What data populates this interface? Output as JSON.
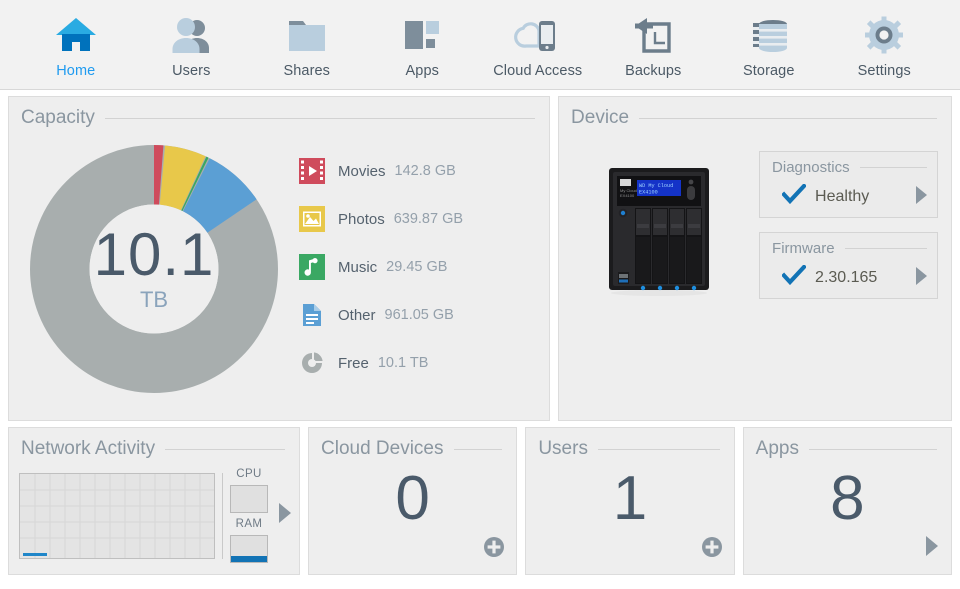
{
  "nav": {
    "items": [
      {
        "label": "Home",
        "icon": "home-icon",
        "active": true
      },
      {
        "label": "Users",
        "icon": "users-icon",
        "active": false
      },
      {
        "label": "Shares",
        "icon": "folder-icon",
        "active": false
      },
      {
        "label": "Apps",
        "icon": "apps-grid-icon",
        "active": false
      },
      {
        "label": "Cloud Access",
        "icon": "cloud-phone-icon",
        "active": false
      },
      {
        "label": "Backups",
        "icon": "backup-arrow-icon",
        "active": false
      },
      {
        "label": "Storage",
        "icon": "storage-disks-icon",
        "active": false
      },
      {
        "label": "Settings",
        "icon": "gear-icon",
        "active": false
      }
    ],
    "active_color": "#1f9bf0",
    "label_color": "#4c5a66"
  },
  "capacity": {
    "title": "Capacity",
    "center_value": "10.1",
    "center_unit": "TB",
    "legend": [
      {
        "name": "Movies",
        "value": "142.8 GB",
        "icon": "film-icon",
        "color": "#cf4b5c"
      },
      {
        "name": "Photos",
        "value": "639.87 GB",
        "icon": "picture-icon",
        "color": "#e8c84a"
      },
      {
        "name": "Music",
        "value": "29.45 GB",
        "icon": "music-icon",
        "color": "#3aa863"
      },
      {
        "name": "Other",
        "value": "961.05 GB",
        "icon": "document-icon",
        "color": "#5b9fd4"
      },
      {
        "name": "Free",
        "value": "10.1 TB",
        "icon": "pie-icon",
        "color": "#a8aeae"
      }
    ]
  },
  "chart_data": {
    "type": "pie",
    "title": "Capacity",
    "center_label": "10.1 TB",
    "unit": "GB",
    "categories": [
      "Movies",
      "Photos",
      "Music",
      "Other",
      "Free"
    ],
    "values": [
      142.8,
      639.87,
      29.45,
      961.05,
      10342.4
    ],
    "value_labels": [
      "142.8 GB",
      "639.87 GB",
      "29.45 GB",
      "961.05 GB",
      "10.1 TB"
    ],
    "colors": [
      "#cf4b5c",
      "#e8c84a",
      "#3aa863",
      "#5b9fd4",
      "#a8aeae"
    ],
    "donut": true,
    "start_angle": 0,
    "legend_position": "right"
  },
  "device": {
    "title": "Device",
    "model_label": "WD My Cloud EX4100",
    "lcd_line1": "WD My Cloud",
    "lcd_line2": "EX4100",
    "diagnostics": {
      "title": "Diagnostics",
      "status": "Healthy",
      "icon": "check-icon",
      "arrow": "triangle-right-icon"
    },
    "firmware": {
      "title": "Firmware",
      "version": "2.30.165",
      "icon": "check-icon",
      "arrow": "triangle-right-icon"
    }
  },
  "network_activity": {
    "title": "Network Activity",
    "cpu_label": "CPU",
    "ram_label": "RAM",
    "cpu_percent": 0,
    "ram_percent": 25,
    "arrow": "triangle-right-icon"
  },
  "cloud_devices": {
    "title": "Cloud Devices",
    "count": "0",
    "action": "add-icon"
  },
  "users_tile": {
    "title": "Users",
    "count": "1",
    "action": "add-icon"
  },
  "apps_tile": {
    "title": "Apps",
    "count": "8",
    "action": "triangle-right-icon"
  },
  "colors": {
    "accent": "#1f9bf0",
    "panel_bg": "#eeeeee",
    "panel_border": "#dcdcdc",
    "title_text": "#8a96a0",
    "number_text": "#4a5a6a",
    "check_blue": "#1273b5"
  }
}
